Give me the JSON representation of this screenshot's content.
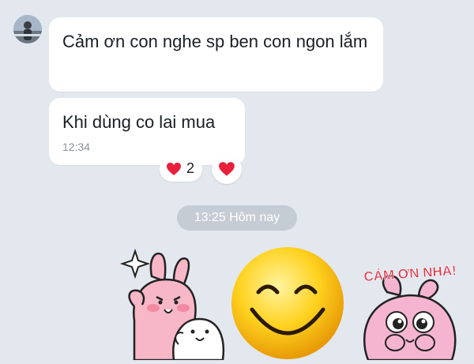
{
  "messages": [
    {
      "text": "Cảm ơn con nghe sp ben con ngon lắm",
      "time": ""
    },
    {
      "text": "Khi dùng co lai mua",
      "time": "12:34"
    }
  ],
  "reaction": {
    "icon": "heart-icon",
    "count": "2"
  },
  "react_button": {
    "icon": "heart-icon"
  },
  "date_separator": "13:25 Hôm nay",
  "stickers": [
    {
      "name": "bunny-sticker"
    },
    {
      "name": "smiley-sticker"
    },
    {
      "name": "thanks-sticker",
      "caption": "CẢM ƠN NHA!"
    }
  ],
  "colors": {
    "background": "#e3e8ef",
    "bubble": "#ffffff",
    "heart": "#e8203b",
    "date_pill": "#c6ccd4"
  }
}
